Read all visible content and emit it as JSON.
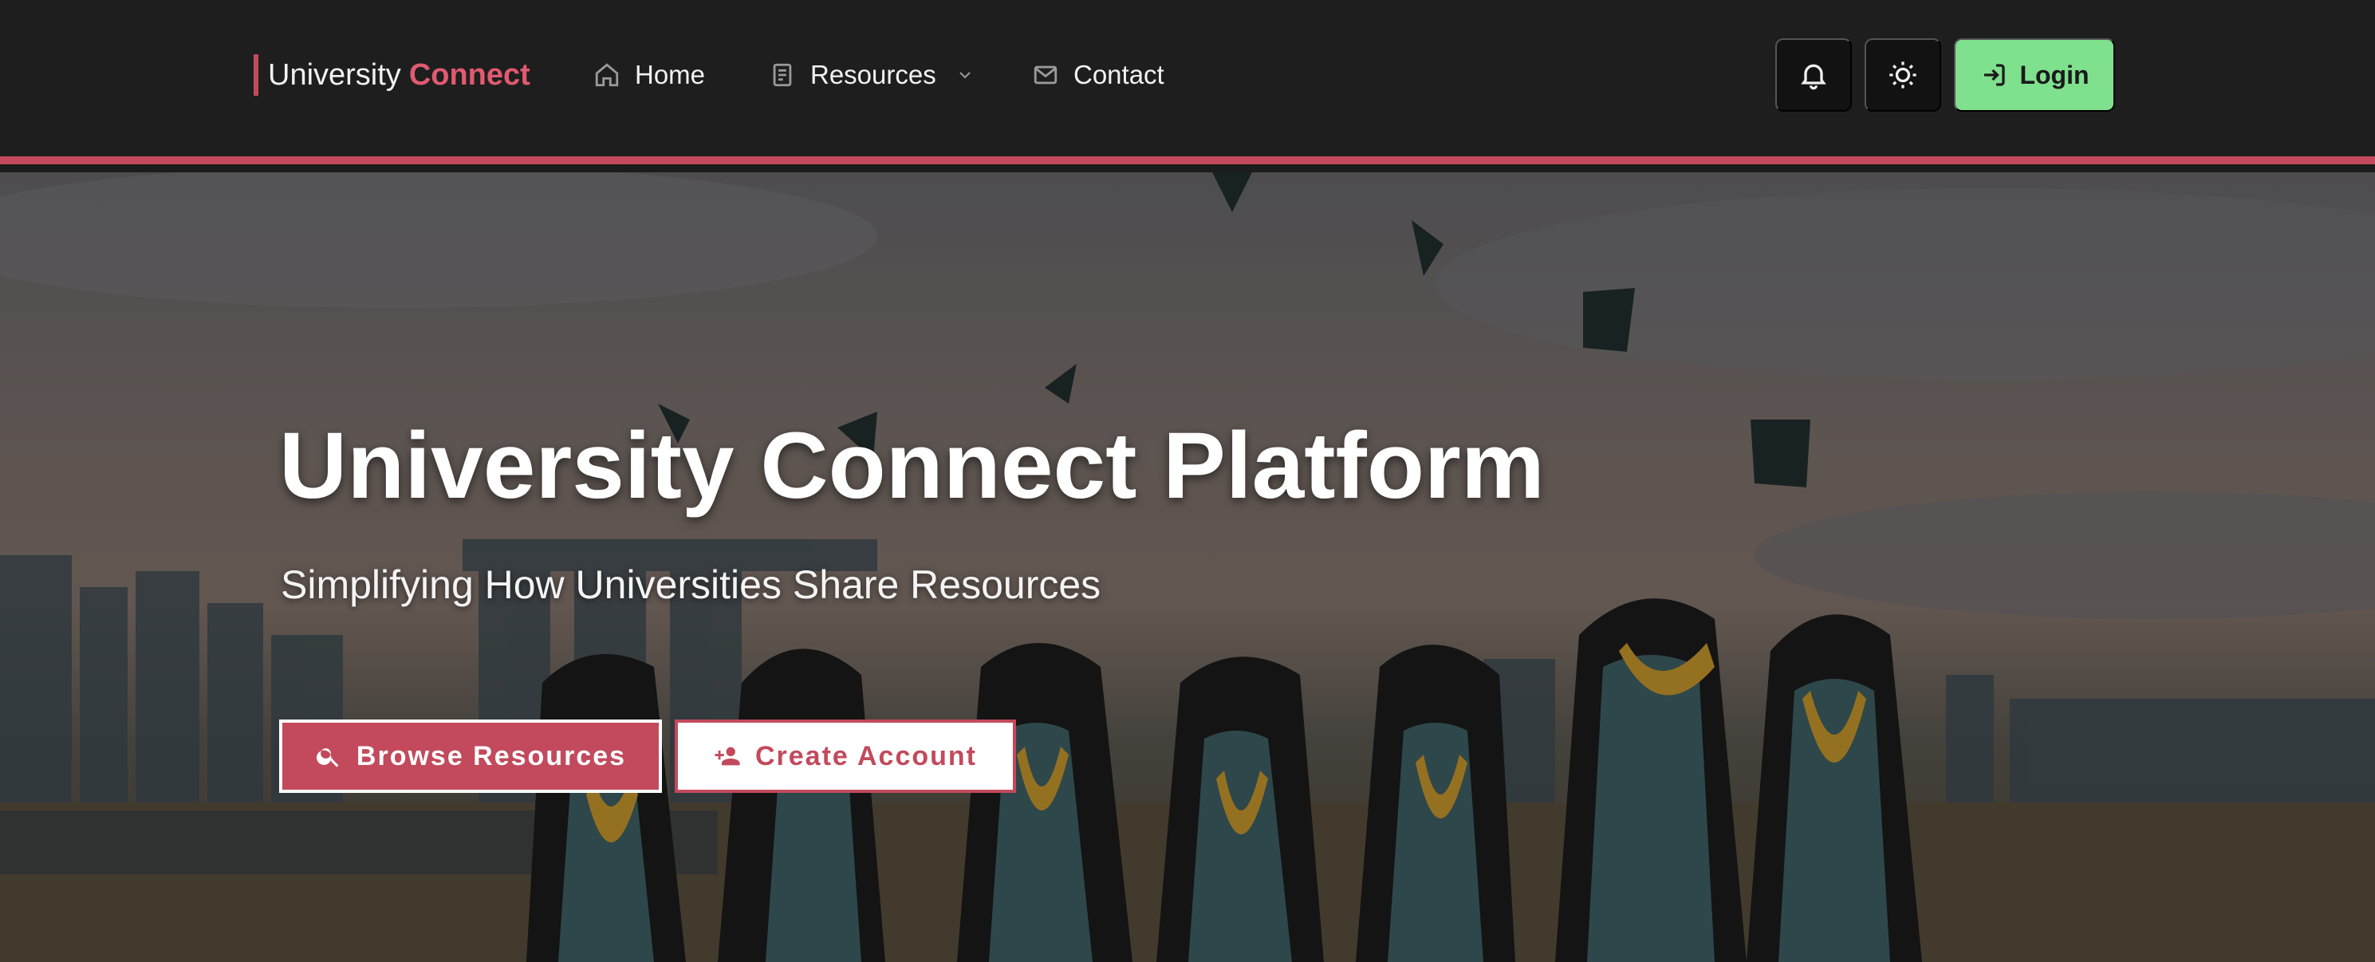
{
  "brand": {
    "name": "University",
    "accent": "Connect"
  },
  "nav": {
    "home": {
      "label": "Home",
      "icon": "home-icon"
    },
    "resources": {
      "label": "Resources",
      "icon": "document-icon"
    },
    "contact": {
      "label": "Contact",
      "icon": "mail-icon"
    }
  },
  "actions": {
    "notifications_icon": "bell-icon",
    "theme_icon": "sun-icon",
    "login_label": "Login",
    "login_icon": "login-icon"
  },
  "hero": {
    "title": "University Connect Platform",
    "subtitle": "Simplifying How Universities Share Resources",
    "browse_label": "Browse Resources",
    "browse_icon": "search-icon",
    "create_label": "Create Account",
    "create_icon": "add-user-icon"
  },
  "colors": {
    "accent": "#c24a5c",
    "brand_accent": "#e05a70",
    "login": "#7fe08e",
    "navbar": "#1e1e1e"
  }
}
